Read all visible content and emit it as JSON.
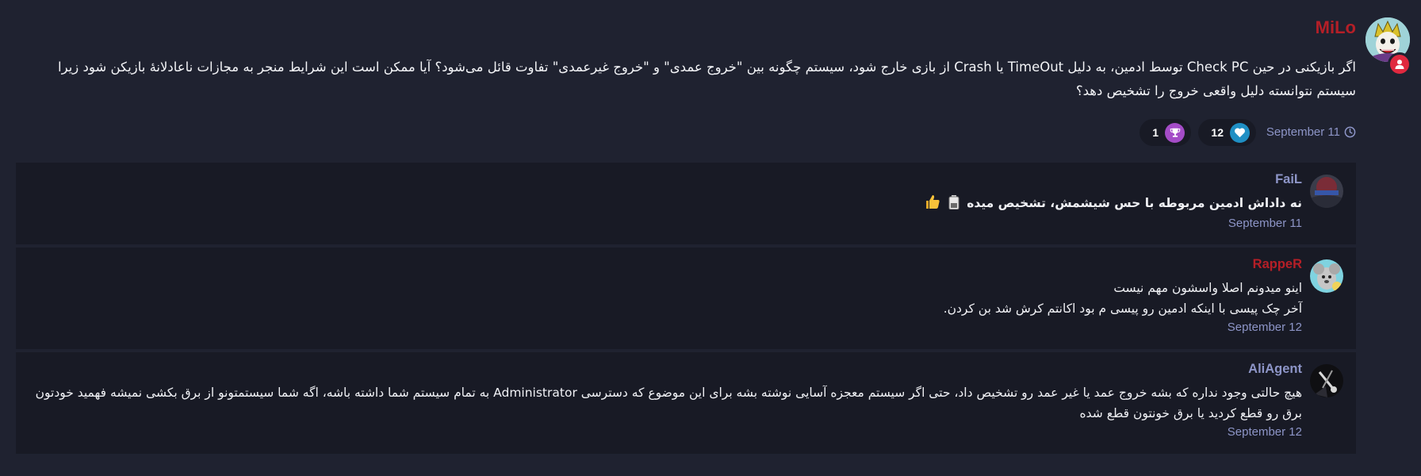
{
  "post": {
    "author": "MiLo",
    "avatar_icon": "joker-avatar-icon",
    "badge_icon": "user-badge-icon",
    "body": "اگر بازیکنی در حین Check PC توسط ادمین، به دلیل TimeOut یا Crash از بازی خارج شود، سیستم چگونه بین \"خروج عمدی\" و \"خروج غیرعمدی\" تفاوت قائل می‌شود؟ آیا ممکن است این شرایط منجر به مجازات ناعادلانهٔ بازیکن شود زیرا سیستم نتوانسته دلیل واقعی خروج را تشخیص دهد؟",
    "time": "September 11",
    "time_icon": "clock-icon",
    "reactions": [
      {
        "icon": "heart-icon",
        "count": "12",
        "color": "#1f8fc4"
      },
      {
        "icon": "trophy-icon",
        "count": "1",
        "color": "#a44cc7"
      }
    ]
  },
  "replies": [
    {
      "author": "FaiL",
      "author_color": "#8d95c7",
      "lines": [
        "نه داداش ادمین مربوطه با حس شیشمش، تشخیص میده"
      ],
      "emojis": [
        "battery-icon",
        "thumbs-up-icon"
      ],
      "time": "September 11"
    },
    {
      "author": "RappeR",
      "author_color": "#b51f27",
      "lines": [
        "اینو میدونم اصلا واسشون مهم نیست",
        "آخر چک پیسی با اینکه ادمین رو پیسی م بود اکانتم کرش شد بن کردن."
      ],
      "time": "September 12"
    },
    {
      "author": "AliAgent",
      "author_color": "#8d95c7",
      "lines": [
        "هیچ حالتی وجود نداره که بشه خروج عمد یا غیر عمد رو تشخیص داد، حتی اگر سیستم معجزه آسایی نوشته بشه برای این موضوع که دسترسی Administrator به تمام سیستم شما داشته باشه، اگه شما سیستمتونو از برق بکشی نمیشه فهمید خودتون برق رو قطع کردید یا برق خونتون قطع شده"
      ],
      "time": "September 12"
    }
  ],
  "colors": {
    "background": "#1f2230",
    "card": "#181a25",
    "meta_text": "#8d95c7",
    "accent_red": "#b51f27"
  }
}
